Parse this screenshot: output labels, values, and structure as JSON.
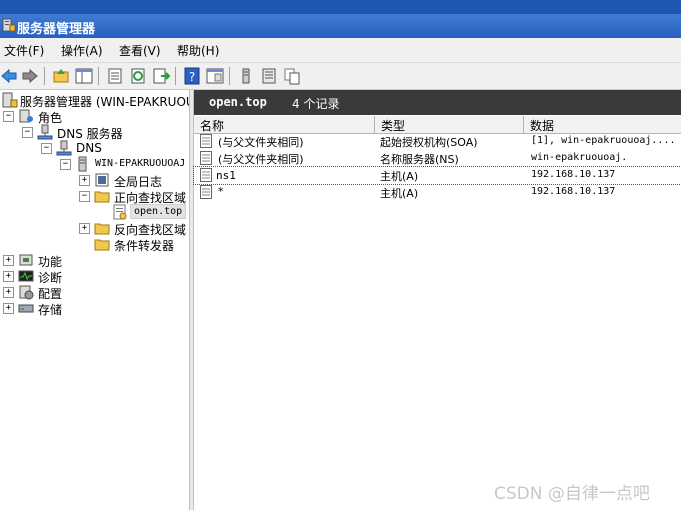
{
  "window": {
    "title": "服务器管理器"
  },
  "menu": {
    "items": [
      "文件(F)",
      "操作(A)",
      "查看(V)",
      "帮助(H)"
    ]
  },
  "toolbar": {
    "buttons": [
      "back-icon",
      "forward-icon",
      "up-folder-icon",
      "show-tree-icon",
      "properties-icon",
      "refresh-icon",
      "export-icon",
      "help-icon",
      "console-view-icon",
      "server-icon",
      "list-icon",
      "copy-icon"
    ]
  },
  "tree": {
    "root": "服务器管理器 (WIN-EPAKRUOUOA",
    "roles": "角色",
    "dns_server": "DNS 服务器",
    "dns": "DNS",
    "host": "WIN-EPAKRUOUOAJ",
    "global_logs": "全局日志",
    "forward_zones": "正向查找区域",
    "zone_open_top": "open.top",
    "reverse_zones": "反向查找区域",
    "conditional_forwarders": "条件转发器",
    "features": "功能",
    "diagnostics": "诊断",
    "configuration": "配置",
    "storage": "存储"
  },
  "details": {
    "zone_name": "open.top",
    "record_count": "4 个记录",
    "columns": [
      "名称",
      "类型",
      "数据"
    ],
    "rows": [
      {
        "name": "(与父文件夹相同)",
        "type": "起始授权机构(SOA)",
        "data": "[1], win-epakruouoaj...."
      },
      {
        "name": "(与父文件夹相同)",
        "type": "名称服务器(NS)",
        "data": "win-epakruouoaj."
      },
      {
        "name": "ns1",
        "type": "主机(A)",
        "data": "192.168.10.137"
      },
      {
        "name": "*",
        "type": "主机(A)",
        "data": "192.168.10.137"
      }
    ]
  },
  "watermark": "CSDN @自律一点吧"
}
